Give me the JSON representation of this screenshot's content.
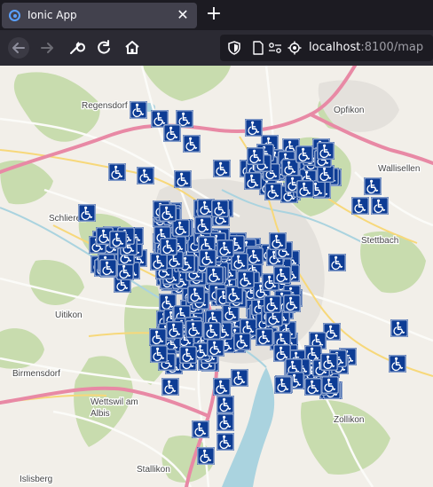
{
  "browser": {
    "tab_title": "Ionic App",
    "tab_close_glyph": "✕",
    "new_tab_glyph": "+",
    "url_host": "localhost",
    "url_rest": ":8100/map"
  },
  "map": {
    "marker_icon": "wheelchair-accessible-icon",
    "marker_color": "#0d3c94",
    "places": [
      {
        "name": "Regensdorf"
      },
      {
        "name": "Opfikon"
      },
      {
        "name": "Wallisellen"
      },
      {
        "name": "Schlieren"
      },
      {
        "name": "Stettbach"
      },
      {
        "name": "Uitikon"
      },
      {
        "name": "Birmensdorf"
      },
      {
        "name": "Wettswil am"
      },
      {
        "name": "Albis"
      },
      {
        "name": "Zollikon"
      },
      {
        "name": "Stallikon"
      },
      {
        "name": "Islisberg"
      }
    ]
  }
}
